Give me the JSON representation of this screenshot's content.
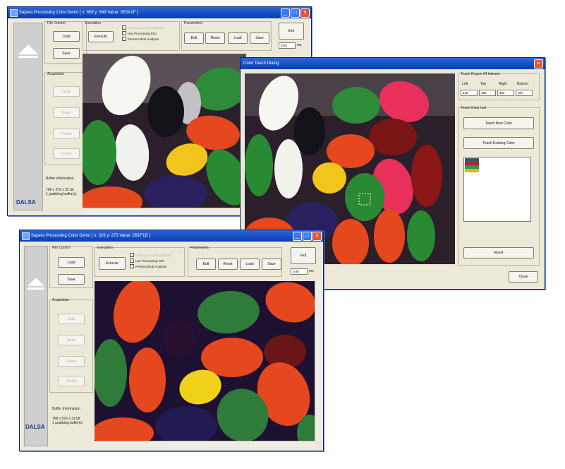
{
  "w1": {
    "title": "Sapera Processing Color Demo  [ x: 658 y: 549 Value: 0E0A1F ]",
    "file_group": "File Control",
    "load": "Load",
    "save": "Save",
    "acq_group": "Acquisition",
    "acq_buttons": [
      "Grab",
      "Snap",
      "Freeze",
      "Config"
    ],
    "exec_group": "Execution",
    "execute": "Execute",
    "checks": [
      "Continuous with grabbing",
      "Use Processing ROI",
      "Perform Blob Analysis"
    ],
    "param_group": "Parameters",
    "params": [
      "Edit",
      "Reset",
      "Load",
      "Save"
    ],
    "exit": "Exit",
    "time": "0.00",
    "time_unit": "ms",
    "buffer_title": "Buffer Information",
    "buffer_info": [
      "768 x 576 x 32 bit",
      "1 grabbing buffer(s)"
    ],
    "logo": "DALSA"
  },
  "w2": {
    "title": "Color Teach Dialog",
    "roi_group": "Teach Region Of Interest",
    "roi_labels": [
      "Left",
      "Top",
      "Right",
      "Bottom"
    ],
    "roi_values": [
      "419",
      "364",
      "452",
      "397"
    ],
    "list_group": "Teach Color List",
    "teach_new": "Teach New Color",
    "teach_existing": "Teach Existing Color",
    "swatches": [
      "#2e5f6e",
      "#b5233a",
      "#2f9a3a",
      "#e9b21b"
    ],
    "reset": "Reset",
    "close": "Close"
  },
  "w3": {
    "title": "Sapera Processing Color Demo  [ x: 326 y: 273 Value: 2B1F1B ]",
    "file_group": "File Control",
    "load": "Load",
    "save": "Save",
    "acq_group": "Acquisition",
    "acq_buttons": [
      "Grab",
      "Snap",
      "Freeze",
      "Config"
    ],
    "exec_group": "Execution",
    "execute": "Execute",
    "checks": [
      "Continuous with grabbing",
      "Use Processing ROI",
      "Perform Blob Analysis"
    ],
    "param_group": "Parameters",
    "params": [
      "Edit",
      "Reset",
      "Load",
      "Save"
    ],
    "exit": "Exit",
    "time": "0.00",
    "time_unit": "ms",
    "buffer_title": "Buffer Information",
    "buffer_info": [
      "768 x 576 x 32 bit",
      "1 grabbing buffer(s)"
    ],
    "logo": "DALSA"
  }
}
